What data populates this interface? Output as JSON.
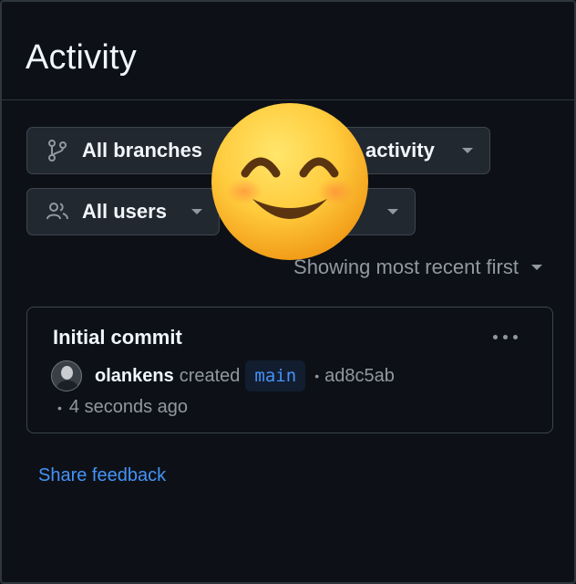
{
  "header": {
    "title": "Activity"
  },
  "filters": {
    "branches": {
      "label": "All branches",
      "icon": "git-branch-icon"
    },
    "activity": {
      "label": "activity"
    },
    "users": {
      "label": "All users",
      "icon": "people-icon"
    },
    "time": {
      "label": "e"
    }
  },
  "sort": {
    "label": "Showing most recent first"
  },
  "activity_items": [
    {
      "title": "Initial commit",
      "user": "olankens",
      "action": "created",
      "branch": "main",
      "sha": "ad8c5ab",
      "time": "4 seconds ago"
    }
  ],
  "footer": {
    "feedback_link": "Share feedback"
  },
  "colors": {
    "background": "#0d1117",
    "border": "#30363d",
    "accent_link": "#4493f8",
    "muted_text": "#9198a1"
  },
  "overlay": {
    "icon": "smiling-face-emoji-icon"
  }
}
